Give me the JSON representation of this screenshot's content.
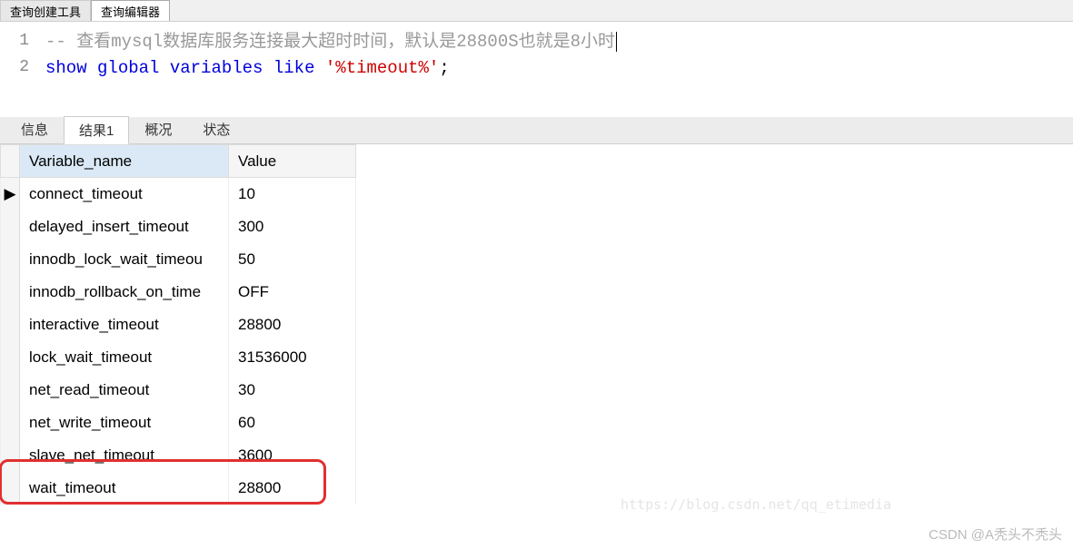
{
  "topTabs": {
    "builder": "查询创建工具",
    "editor": "查询编辑器"
  },
  "sql": {
    "line1_number": "1",
    "line1_prefix": "-- ",
    "line1_comment": "查看mysql数据库服务连接最大超时时间，默认是28800S也就是8小时",
    "line2_number": "2",
    "line2_kw1": "show",
    "line2_kw2": "global",
    "line2_kw3": "variables",
    "line2_kw4": "like",
    "line2_str": "'%timeout%'",
    "line2_semi": ";"
  },
  "resultTabs": {
    "info": "信息",
    "result1": "结果1",
    "profile": "概况",
    "status": "状态"
  },
  "columns": {
    "name": "Variable_name",
    "value": "Value"
  },
  "rows": [
    {
      "name": "connect_timeout",
      "value": "10",
      "current": true
    },
    {
      "name": "delayed_insert_timeout",
      "value": "300"
    },
    {
      "name": "innodb_lock_wait_timeou",
      "value": "50"
    },
    {
      "name": "innodb_rollback_on_time",
      "value": "OFF"
    },
    {
      "name": "interactive_timeout",
      "value": "28800"
    },
    {
      "name": "lock_wait_timeout",
      "value": "31536000"
    },
    {
      "name": "net_read_timeout",
      "value": "30"
    },
    {
      "name": "net_write_timeout",
      "value": "60"
    },
    {
      "name": "slave_net_timeout",
      "value": "3600"
    },
    {
      "name": "wait_timeout",
      "value": "28800",
      "highlight": true
    }
  ],
  "watermark": "CSDN @A秃头不秃头",
  "fadedUrl": "https://blog.csdn.net/qq_etimedia"
}
